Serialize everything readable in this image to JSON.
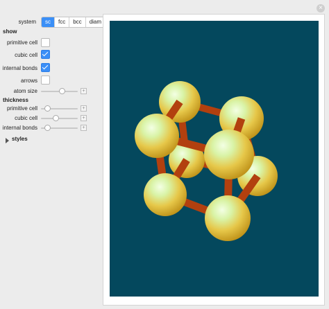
{
  "controls": {
    "system_label": "system",
    "system_options": [
      "sc",
      "fcc",
      "bcc",
      "diam"
    ],
    "system_selected": "sc",
    "show_heading": "show",
    "primitive_cell_label": "primitive cell",
    "primitive_cell_checked": false,
    "cubic_cell_label": "cubic cell",
    "cubic_cell_checked": true,
    "internal_bonds_label": "internal bonds",
    "internal_bonds_checked": true,
    "arrows_label": "arrows",
    "arrows_checked": false,
    "atom_size_label": "atom size",
    "atom_size_value": 0.58,
    "thickness_heading": "thickness",
    "thickness_primitive_label": "primitive cell",
    "thickness_primitive_value": 0.12,
    "thickness_cubic_label": "cubic cell",
    "thickness_cubic_value": 0.38,
    "thickness_bonds_label": "internal bonds",
    "thickness_bonds_value": 0.12,
    "styles_label": "styles"
  },
  "view": {
    "background": "#04485d",
    "atom_color": "#e8c84a",
    "bond_color": "#b83a10"
  }
}
